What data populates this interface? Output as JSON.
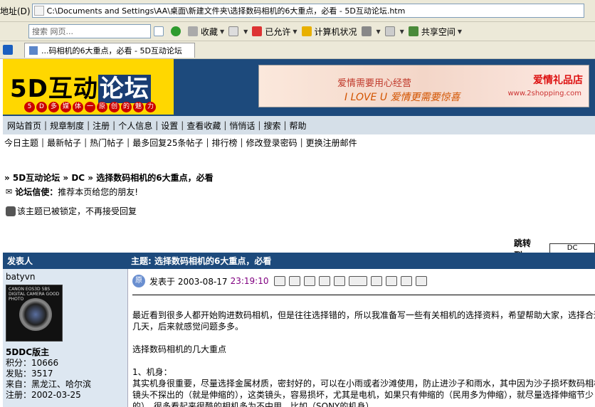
{
  "browser": {
    "address_label": "地址(D)",
    "address_value": "C:\\Documents and Settings\\AA\\桌面\\新建文件夹\\选择数码相机的6大重点，必看 - 5D互动论坛.htm",
    "search_placeholder": "搜索 网页...",
    "toolbar": {
      "favorites": "收藏",
      "allowed": "已允许",
      "computer_status": "计算机状况",
      "shared_space": "共享空间"
    },
    "tab_title": "...码相机的6大重点，必看 - 5D互动论坛"
  },
  "site": {
    "logo_text_a": "5D互动",
    "logo_text_b": "论坛",
    "logo_tagline": [
      "5",
      "D",
      "多",
      "媒",
      "体",
      "一",
      "原",
      "创",
      "的",
      "魅",
      "力"
    ],
    "ad_line1": "爱情需要用心经营",
    "ad_line2": "I LOVE U 爱情更需要惊喜",
    "ad_shop": "爱情礼品店",
    "ad_url": "www.2shopping.com",
    "nav_main": [
      "网站首页",
      "规章制度",
      "注册",
      "个人信息",
      "设置",
      "查看收藏",
      "悄悄话",
      "搜索",
      "帮助"
    ],
    "nav_sub": [
      "今日主题",
      "最新帖子",
      "热门帖子",
      "最多回复25条帖子",
      "排行榜",
      "修改登录密码",
      "更换注册邮件"
    ]
  },
  "breadcrumb": "» 5D互动论坛 » DC » 选择数码相机的6大重点，必看",
  "messenger": {
    "label": "论坛信使：",
    "text": "推荐本页给您的朋友!"
  },
  "lock_notice": "该主题已被锁定，不再接受回复",
  "jump": {
    "label": "跳转到：",
    "value": "DC"
  },
  "thread": {
    "col_author": "发表人",
    "col_subject": "主题: 选择数码相机的6大重点，必看"
  },
  "author": {
    "name": "batyvn",
    "avatar_caption": "CANON EOS3D 5BS DIGITAL CAMERA GOOD PHOTO",
    "title": "5DDC版主",
    "points": "积分：10666",
    "posts": "发贴：3517",
    "from": "来自：黑龙江、哈尔滨",
    "registered": "注册：2002-03-25"
  },
  "post": {
    "orig_badge": "原",
    "posted_at": "发表于 2003-08-17",
    "time": "23:19:10",
    "para1": "最近看到很多人都开始购进数码相机，但是往往选择错的，所以我准备写一些有关相机的选择资料，希望帮助大家，选择合适",
    "para1b": "几天，后来就感觉问题多多。",
    "para2": "选择数码相机的几大重点",
    "para3": "1、机身：",
    "para4": "其实机身很重要，尽量选择金属材质，密封好的，可以在小雨或者沙滩使用，防止进沙子和雨水，其中因为沙子损坏数码相机",
    "para5": "镜头不探出的（就是伸缩的），这类镜头，容易损坏，尤其是电机，如果只有伸缩的（民用多为伸缩），就尽量选择伸缩节少",
    "para6": "的），很多看起来很酷的相机多为不中用，比如（SONY的机身）。"
  }
}
